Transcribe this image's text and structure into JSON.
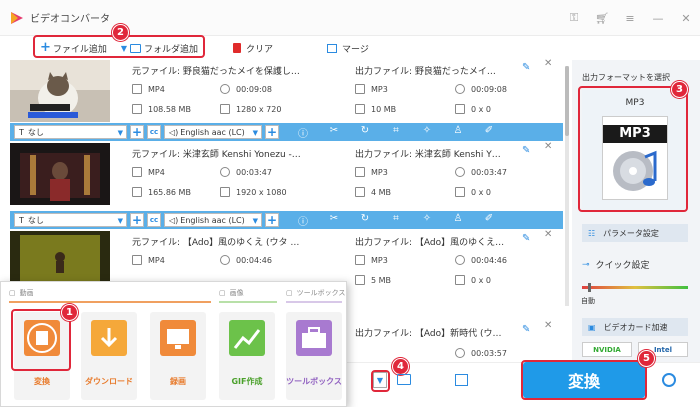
{
  "app": {
    "title": "ビデオコンバータ"
  },
  "toolbar": {
    "add_file": "ファイル追加",
    "add_folder": "フォルダ追加",
    "clear": "クリア",
    "merge": "マージ"
  },
  "files": [
    {
      "src_name": "元ファイル: 野良猫だったメイを保護し…",
      "dst_name": "出力ファイル: 野良猫だったメイ…",
      "src_format": "MP4",
      "src_duration": "00:09:08",
      "src_size": "108.58 MB",
      "src_res": "1280 x 720",
      "dst_format": "MP3",
      "dst_duration": "00:09:08",
      "dst_size": "10 MB",
      "dst_res": "0 x 0",
      "subtitle": "なし",
      "audio": "English aac (LC)"
    },
    {
      "src_name": "元ファイル: 米津玄師 Kenshi Yonezu -…",
      "dst_name": "出力ファイル: 米津玄師 Kenshi Y…",
      "src_format": "MP4",
      "src_duration": "00:03:47",
      "src_size": "165.86 MB",
      "src_res": "1920 x 1080",
      "dst_format": "MP3",
      "dst_duration": "00:03:47",
      "dst_size": "4 MB",
      "dst_res": "0 x 0",
      "subtitle": "なし",
      "audio": "English aac (LC)"
    },
    {
      "src_name": "元ファイル: 【Ado】風のゆくえ (ウタ …",
      "dst_name": "出力ファイル: 【Ado】風のゆくえ…",
      "src_format": "MP4",
      "src_duration": "00:04:46",
      "dst_format": "MP3",
      "dst_duration": "00:04:46",
      "dst_size": "5 MB",
      "dst_res": "0 x 0"
    },
    {
      "dst_name": "出力ファイル: 【Ado】新時代 (ウ…",
      "dst_duration": "00:03:57"
    }
  ],
  "right_panel": {
    "format_label": "出力フォーマットを選択",
    "format_name": "MP3",
    "format_icon_text": "MP3",
    "param_button": "パラメータ設定",
    "quick_label": "クイック設定",
    "slider_label": "自動",
    "gpu_button": "ビデオカード加速",
    "gpu_tags": [
      "NVIDIA",
      "Intel"
    ]
  },
  "popup": {
    "section_video": "動画",
    "section_image": "画像",
    "section_tools": "ツールボックス",
    "tools": [
      "変換",
      "ダウンロード",
      "録画",
      "GIF作成",
      "ツールボックス"
    ]
  },
  "convert_button": "変換",
  "badges": [
    "1",
    "2",
    "3",
    "4",
    "5"
  ],
  "colors": {
    "accent": "#1f9ae8",
    "annotation": "#e0273a",
    "toolbar_blue": "#5aafe8"
  }
}
